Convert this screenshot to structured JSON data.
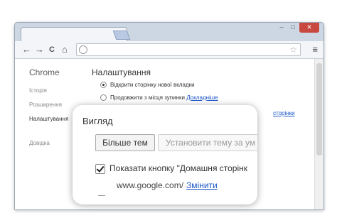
{
  "browser": {
    "tab_close": "×",
    "window_controls": {
      "minimize": "–",
      "maximize": "□",
      "close": "✕"
    },
    "nav": {
      "back": "←",
      "forward": "→",
      "reload": "C",
      "home": "⌂"
    },
    "omnibox": {
      "value": "",
      "star": "☆"
    },
    "menu": "≡"
  },
  "sidebar": {
    "app_title": "Chrome",
    "items": [
      {
        "label": "Історія"
      },
      {
        "label": "Розширення"
      },
      {
        "label": "Налаштування"
      },
      {
        "label": "Довідка"
      }
    ]
  },
  "settings": {
    "title": "Налаштування",
    "options": [
      {
        "label": "Відкрити сторінку нової вкладки",
        "selected": true
      },
      {
        "label": "Продовжити з місця зупинки",
        "link": "Докладніше",
        "selected": false
      }
    ],
    "partial_link": "сторінки"
  },
  "appearance": {
    "heading": "Вигляд",
    "more_themes": "Більше тем",
    "set_theme": "Установити тему за ум",
    "show_home_button": "Показати кнопку \"Домашня сторінк",
    "homepage_url": "www.google.com/",
    "change_link": "Змінити",
    "show_home_checked": true
  }
}
